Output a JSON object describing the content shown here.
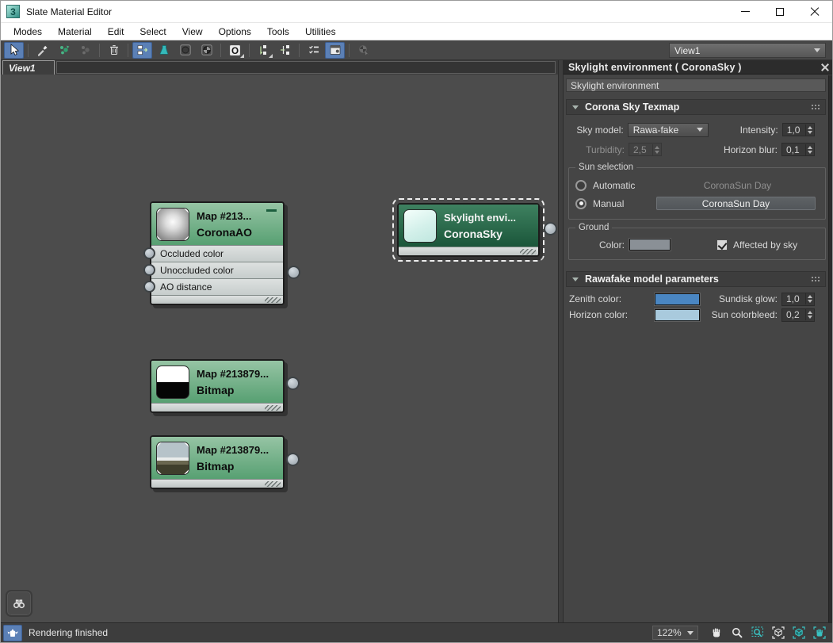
{
  "window": {
    "title": "Slate Material Editor"
  },
  "menu": {
    "items": [
      "Modes",
      "Material",
      "Edit",
      "Select",
      "View",
      "Options",
      "Tools",
      "Utilities"
    ]
  },
  "toolbar": {
    "view_selector": "View1"
  },
  "graph": {
    "tab": "View1",
    "nodes": {
      "coronaao": {
        "title": "Map #213...",
        "subtitle": "CoronaAO",
        "slots": [
          "Occluded color",
          "Unoccluded color",
          "AO distance"
        ]
      },
      "skylight": {
        "title": "Skylight envi...",
        "subtitle": "CoronaSky"
      },
      "bitmap1": {
        "title": "Map #213879...",
        "subtitle": "Bitmap"
      },
      "bitmap2": {
        "title": "Map #213879...",
        "subtitle": "Bitmap"
      }
    }
  },
  "panel": {
    "title": "Skylight environment  ( CoronaSky )",
    "name_field": "Skylight environment",
    "corona_sky": {
      "title": "Corona Sky Texmap",
      "sky_model_label": "Sky model:",
      "sky_model_value": "Rawa-fake",
      "intensity_label": "Intensity:",
      "intensity_value": "1,0",
      "turbidity_label": "Turbidity:",
      "turbidity_value": "2,5",
      "horizon_blur_label": "Horizon blur:",
      "horizon_blur_value": "0,1",
      "sun_selection": {
        "legend": "Sun selection",
        "automatic_label": "Automatic",
        "automatic_value": "CoronaSun Day",
        "manual_label": "Manual",
        "manual_button": "CoronaSun Day"
      },
      "ground": {
        "legend": "Ground",
        "color_label": "Color:",
        "color_value": "#8a9096",
        "affected_label": "Affected by sky"
      }
    },
    "rawafake": {
      "title": "Rawafake model parameters",
      "zenith_label": "Zenith color:",
      "zenith_color": "#4a86c2",
      "horizon_label": "Horizon color:",
      "horizon_color": "#a9cadd",
      "sundisk_label": "Sundisk glow:",
      "sundisk_value": "1,0",
      "colorbleed_label": "Sun colorbleed:",
      "colorbleed_value": "0,2"
    }
  },
  "statusbar": {
    "message": "Rendering finished",
    "zoom": "122%"
  }
}
